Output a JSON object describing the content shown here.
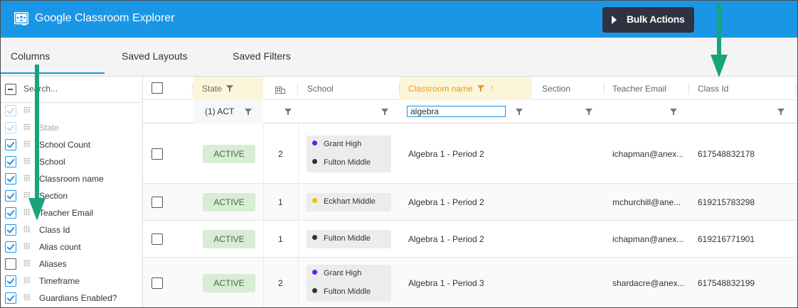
{
  "app": {
    "title": "Google Classroom Explorer",
    "bulk_actions_label": "Bulk Actions",
    "accent": "#1a96e6"
  },
  "tabs": [
    {
      "label": "Columns",
      "active": true
    },
    {
      "label": "Saved Layouts",
      "active": false
    },
    {
      "label": "Saved Filters",
      "active": false
    }
  ],
  "column_panel": {
    "search_placeholder": "Search...",
    "items": [
      {
        "label": "",
        "checked": true,
        "disabled": true
      },
      {
        "label": "State",
        "checked": true,
        "disabled": true
      },
      {
        "label": "School Count",
        "checked": true,
        "disabled": false
      },
      {
        "label": "School",
        "checked": true,
        "disabled": false
      },
      {
        "label": "Classroom name",
        "checked": true,
        "disabled": false
      },
      {
        "label": "Section",
        "checked": true,
        "disabled": false
      },
      {
        "label": "Teacher Email",
        "checked": true,
        "disabled": false
      },
      {
        "label": "Class Id",
        "checked": true,
        "disabled": false
      },
      {
        "label": "Alias count",
        "checked": true,
        "disabled": false
      },
      {
        "label": "Aliases",
        "checked": false,
        "disabled": false
      },
      {
        "label": "Timeframe",
        "checked": true,
        "disabled": false
      },
      {
        "label": "Guardians Enabled?",
        "checked": true,
        "disabled": false
      }
    ]
  },
  "grid": {
    "headers": {
      "state": "State",
      "school": "School",
      "classroom_name": "Classroom name",
      "section": "Section",
      "teacher_email": "Teacher Email",
      "class_id": "Class Id"
    },
    "filters": {
      "state": "(1) ACT",
      "classroom_name": "algebra"
    },
    "rows": [
      {
        "state": "ACTIVE",
        "school_count": "2",
        "schools": [
          {
            "name": "Grant High",
            "color": "#6a1de0"
          },
          {
            "name": "Fulton Middle",
            "color": "#1e3d2a"
          }
        ],
        "classroom": "Algebra 1 - Period 2",
        "email": "ichapman@anex...",
        "class_id": "617548832178"
      },
      {
        "state": "ACTIVE",
        "school_count": "1",
        "schools": [
          {
            "name": "Eckhart Middle",
            "color": "#f2c200"
          }
        ],
        "classroom": "Algebra 1 - Period 2",
        "email": "mchurchill@ane...",
        "class_id": "619215783298"
      },
      {
        "state": "ACTIVE",
        "school_count": "1",
        "schools": [
          {
            "name": "Fulton Middle",
            "color": "#1e3d2a"
          }
        ],
        "classroom": "Algebra 1 - Period 2",
        "email": "ichapman@anex...",
        "class_id": "619216771901"
      },
      {
        "state": "ACTIVE",
        "school_count": "2",
        "schools": [
          {
            "name": "Grant High",
            "color": "#6a1de0"
          },
          {
            "name": "Fulton Middle",
            "color": "#1e3d2a"
          }
        ],
        "classroom": "Algebra 1 - Period 3",
        "email": "shardacre@anex...",
        "class_id": "617548832199"
      }
    ]
  },
  "annotation_arrow_color": "#1aa37a"
}
